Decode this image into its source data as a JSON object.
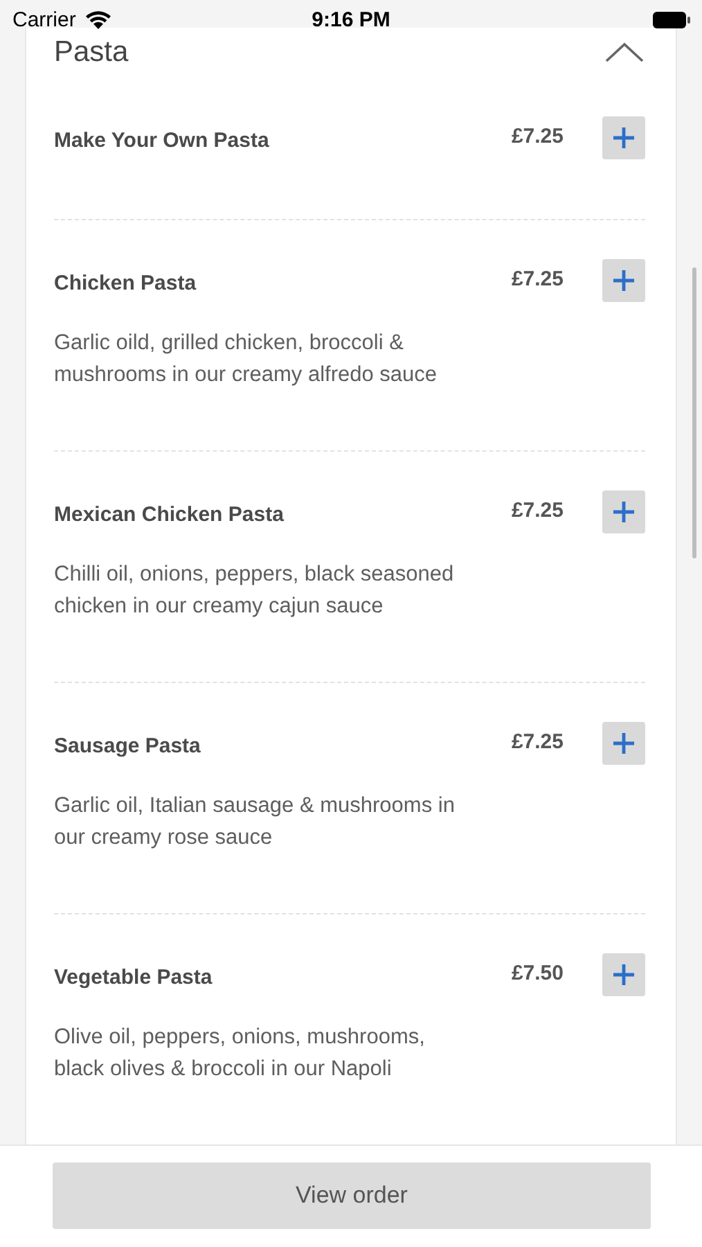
{
  "status_bar": {
    "carrier": "Carrier",
    "time": "9:16 PM"
  },
  "section": {
    "title": "Pasta",
    "expanded": true,
    "items": [
      {
        "name": "Make Your Own Pasta",
        "price": "£7.25"
      },
      {
        "name": "Chicken Pasta",
        "price": "£7.25",
        "description": "Garlic oild, grilled chicken, broccoli & mushrooms in our creamy alfredo sauce"
      },
      {
        "name": "Mexican Chicken Pasta",
        "price": "£7.25",
        "description": "Chilli oil, onions, peppers, black seasoned chicken in our creamy cajun sauce"
      },
      {
        "name": "Sausage Pasta",
        "price": "£7.25",
        "description": "Garlic oil, Italian sausage & mushrooms in our creamy rose sauce"
      },
      {
        "name": "Vegetable Pasta",
        "price": "£7.50",
        "description": "Olive oil, peppers, onions, mushrooms, black olives & broccoli in our Napoli"
      }
    ]
  },
  "order_button": {
    "label": "View order",
    "disabled": true
  }
}
